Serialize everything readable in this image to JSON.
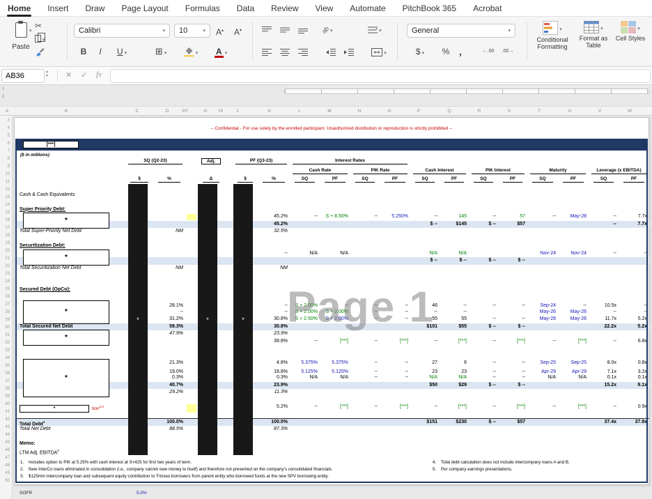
{
  "icons": {
    "chevron": "▾",
    "scissors": "✂",
    "up": "▴"
  },
  "ribbon": {
    "tabs": [
      {
        "label": "Home",
        "active": true
      },
      {
        "label": "Insert"
      },
      {
        "label": "Draw"
      },
      {
        "label": "Page Layout"
      },
      {
        "label": "Formulas"
      },
      {
        "label": "Data"
      },
      {
        "label": "Review"
      },
      {
        "label": "View"
      },
      {
        "label": "Automate"
      },
      {
        "label": "PitchBook 365"
      },
      {
        "label": "Acrobat"
      }
    ],
    "paste_label": "Paste",
    "font_name": "Calibri",
    "font_size": "10",
    "increase_font_label": "A",
    "decrease_font_label": "A",
    "bold_label": "B",
    "italic_label": "I",
    "underline_label": "U",
    "font_color_label": "A",
    "number_format": "General",
    "currency_label": "$",
    "percent_label": "%",
    "comma_label": ",",
    "increase_decimal": "←.00",
    "decrease_decimal": ".00→",
    "conditional_formatting_label": "Conditional Formatting",
    "format_as_table_label": "Format as Table",
    "cell_styles_label": "Cell Styles"
  },
  "formula_bar": {
    "name_box": "AB36",
    "cancel": "✕",
    "enter": "✓",
    "fx": "fx"
  },
  "sheet_chrome": {
    "column_letters": [
      "A",
      "B",
      "C",
      "D",
      "EF",
      "G",
      "HI",
      "J",
      "K",
      "L",
      "M",
      "N",
      "O",
      "P",
      "Q",
      "R",
      "S",
      "T",
      "U",
      "V",
      "W"
    ],
    "row_numbers": [
      "1",
      "2",
      "3",
      "4",
      "5",
      "6",
      "7",
      "8",
      "9",
      "10",
      "11",
      "12",
      "13",
      "14",
      "15",
      "16",
      "17",
      "18",
      "19",
      "20",
      "21",
      "22",
      "23",
      "24",
      "25",
      "26",
      "27",
      "28",
      "29",
      "30",
      "31",
      "32",
      "33",
      "34",
      "35",
      "36",
      "37",
      "38",
      "39",
      "40",
      "41",
      "42",
      "43",
      "44",
      "45",
      "46",
      "47",
      "48",
      "49",
      "50"
    ]
  },
  "sheet": {
    "confidential": "-- Confidential - For use solely by the enrolled participant. Unauthorized distribution or reproduction is strictly prohibited --",
    "title_box": "[***]",
    "units": "($ in millions)",
    "watermark": "Page 1",
    "redaction_mark": "*",
    "headers": {
      "h1": [
        {
          "t": "SQ (Q2-23)",
          "s": "cd"
        },
        {
          "t": "Adj.",
          "s": "g",
          "box": true
        },
        {
          "t": "PF (Q3-23)",
          "s": "jk"
        },
        {
          "t": "Interest Rates",
          "s": "lo"
        }
      ],
      "h2": [
        {
          "t": "Cash Rate",
          "s": "lm"
        },
        {
          "t": "PIK Rate",
          "s": "no"
        },
        {
          "t": "Cash Interest",
          "s": "pq"
        },
        {
          "t": "PIK Interest",
          "s": "rs"
        },
        {
          "t": "Maturity",
          "s": "tu"
        },
        {
          "t": "Leverage (x EBITDA)",
          "s": "vw"
        }
      ],
      "h3": [
        {
          "t": "$",
          "col": "c"
        },
        {
          "t": "%",
          "col": "d"
        },
        {
          "t": "Δ",
          "col": "g"
        },
        {
          "t": "$",
          "col": "j"
        },
        {
          "t": "%",
          "col": "k"
        },
        {
          "t": "SQ",
          "col": "l"
        },
        {
          "t": "PF",
          "col": "m"
        },
        {
          "t": "SQ",
          "col": "n"
        },
        {
          "t": "PF",
          "col": "o"
        },
        {
          "t": "SQ",
          "col": "p"
        },
        {
          "t": "PF",
          "col": "q"
        },
        {
          "t": "SQ",
          "col": "r"
        },
        {
          "t": "PF",
          "col": "s"
        },
        {
          "t": "SQ",
          "col": "t"
        },
        {
          "t": "PF",
          "col": "u"
        },
        {
          "t": "SQ",
          "col": "v"
        },
        {
          "t": "PF",
          "col": "w"
        }
      ]
    },
    "rows": [
      {},
      {
        "n": "Cash & Cash Equivalents"
      },
      {},
      {
        "n": "Super Priority Debt:",
        "s": "sec"
      },
      {
        "y": true,
        "c": [
          "",
          "45.2%",
          "--",
          [
            "S + 8.50%",
            "g"
          ],
          "--",
          [
            "5.250%",
            "bl"
          ],
          "--",
          [
            "145",
            "g"
          ],
          "--",
          [
            "57",
            "g"
          ],
          "--",
          [
            "May-28",
            "bl"
          ],
          "--",
          "7.7x"
        ]
      },
      {
        "s": "tot",
        "c": [
          "",
          "45.2%",
          "",
          "",
          "",
          "",
          "$ --",
          "$145",
          "$ --",
          "$57",
          "",
          "",
          "--",
          "7.7x"
        ]
      },
      {
        "n": "Total Super-Priority Net Debt",
        "s": "it",
        "c": [
          "NM",
          "32.5%",
          "",
          "",
          "",
          "",
          "",
          "",
          "",
          "",
          "",
          "",
          "",
          ""
        ]
      },
      {},
      {
        "n": "Securitization Debt:",
        "s": "sec"
      },
      {
        "c": [
          "",
          "--",
          "N/A",
          "N/A",
          "",
          "",
          [
            "N/A",
            "g"
          ],
          [
            "N/A",
            "g"
          ],
          "",
          "",
          [
            "Nov-24",
            "bl"
          ],
          [
            "Nov-24",
            "bl"
          ],
          "--",
          "--"
        ]
      },
      {
        "s": "tot",
        "c": [
          "",
          "",
          "",
          "",
          "",
          "",
          "$ --",
          "$ --",
          "$ --",
          "$ --",
          "",
          "",
          "",
          ""
        ]
      },
      {
        "n": "Total Securitization Net Debt",
        "s": "it",
        "c": [
          "NM",
          "NM",
          "",
          "",
          "",
          "",
          "",
          "",
          "",
          "",
          "",
          "",
          "",
          ""
        ]
      },
      {},
      {},
      {
        "n": "Secured Debt (OpCo):",
        "s": "sec"
      },
      {},
      {
        "y": true,
        "c": [
          "28.1%",
          "--",
          [
            "S + 2.00%",
            "g"
          ],
          "--",
          "--",
          "--",
          "46",
          "--",
          "--",
          "--",
          [
            "Sep-24",
            "bl"
          ],
          "--",
          "10.5x",
          "--"
        ]
      },
      {
        "c": [
          "--",
          "--",
          [
            "S + 2.00%",
            "g"
          ],
          [
            "S + 2.00%",
            "g"
          ],
          "--",
          "--",
          "--",
          "--",
          "",
          "",
          [
            "May-26",
            "bl"
          ],
          [
            "May-26",
            "bl"
          ],
          "--",
          "--"
        ]
      },
      {
        "c": [
          "31.2%",
          "30.8%",
          [
            "S + 2.50%",
            "g"
          ],
          [
            "S + 2.50%",
            "bl"
          ],
          "--",
          "--",
          "55",
          "55",
          "--",
          "--",
          [
            "May-28",
            "bl"
          ],
          [
            "May-26",
            "bl"
          ],
          "11.7x",
          "5.2x"
        ]
      },
      {
        "n": "Total Secured Net Debt",
        "s": "tot",
        "c": [
          "59.3%",
          "30.8%",
          "",
          "",
          "",
          "",
          "$101",
          "$55",
          "$ --",
          "$ --",
          "",
          "",
          "22.2x",
          "5.2x"
        ]
      },
      {
        "s": "it",
        "c": [
          "47.9%",
          "23.9%",
          "",
          "",
          "",
          "",
          "",
          "",
          "",
          "",
          "",
          "",
          "",
          ""
        ]
      },
      {
        "c": [
          "",
          "39.8%",
          "--",
          [
            "[***]",
            "g"
          ],
          "--",
          [
            "[***]",
            "g"
          ],
          "--",
          [
            "[***]",
            "g"
          ],
          "--",
          [
            "[***]",
            "g"
          ],
          "--",
          [
            "[***]",
            "g"
          ],
          "--",
          "6.8x"
        ]
      },
      {},
      {},
      {
        "c": [
          "21.3%",
          "4.8%",
          [
            "5.375%",
            "bl"
          ],
          [
            "5.375%",
            "bl"
          ],
          "--",
          "--",
          "27",
          "6",
          "--",
          "--",
          [
            "Sep-25",
            "bl"
          ],
          [
            "Sep-25",
            "bl"
          ],
          "8.0x",
          "0.8x"
        ]
      },
      {
        "y": true,
        "c": [
          "19.0%",
          "18.8%",
          [
            "5.125%",
            "bl"
          ],
          [
            "5.125%",
            "bl"
          ],
          "--",
          "--",
          "23",
          "23",
          "--",
          "--",
          [
            "Apr-29",
            "bl"
          ],
          [
            "Apr-29",
            "bl"
          ],
          "7.1x",
          "3.2x"
        ]
      },
      {
        "c": [
          "0.3%",
          "0.3%",
          "N/A",
          "N/A",
          "--",
          "--",
          [
            "N/A",
            "g"
          ],
          [
            "N/A",
            "g"
          ],
          "--",
          "--",
          "N/A",
          "N/A",
          "0.1x",
          "0.1x"
        ]
      },
      {
        "s": "tot",
        "c": [
          "40.7%",
          "23.9%",
          "",
          "",
          "",
          "",
          "$50",
          "$29",
          "$ --",
          "$ --",
          "",
          "",
          "15.2x",
          "9.1x"
        ]
      },
      {
        "s": "it",
        "c": [
          "29.2%",
          "11.3%",
          "",
          "",
          "",
          "",
          "",
          "",
          "",
          "",
          "",
          "",
          "",
          ""
        ]
      },
      {},
      {
        "n": "tion",
        "sup": "2,3",
        "s": "redlbl",
        "y": true,
        "c": [
          "",
          "5.2%",
          "--",
          [
            "[***]",
            "g"
          ],
          "--",
          [
            "[***]",
            "g"
          ],
          "--",
          [
            "[***]",
            "g"
          ],
          "--",
          [
            "[***]",
            "g"
          ],
          "--",
          [
            "[***]",
            "g"
          ],
          "--",
          "0.9x"
        ]
      },
      {},
      {
        "n": "Total Debt",
        "sup": "4",
        "s": "tot2",
        "c": [
          "100.0%",
          "100.0%",
          "",
          "",
          "",
          "",
          "$151",
          "$230",
          "$ --",
          "$57",
          "",
          "",
          "37.4x",
          "37.9x"
        ]
      },
      {
        "n": "Total Net Debt",
        "s": "it",
        "c": [
          "88.5%",
          "87.3%",
          "",
          "",
          "",
          "",
          "",
          "",
          "",
          "",
          "",
          "",
          "",
          ""
        ]
      },
      {},
      {
        "n": "Memo:",
        "s": "b"
      },
      {
        "n": "LTM Adj. EBITDA",
        "sup": "5"
      }
    ],
    "redaction_boxes": [
      {
        "rows": [
          4,
          5
        ]
      },
      {
        "rows": [
          9,
          10
        ]
      },
      {
        "rows": [
          16,
          18
        ]
      },
      {
        "rows": [
          20,
          21
        ]
      },
      {
        "rows": [
          24,
          28
        ]
      }
    ],
    "redaction_bars": [
      {
        "col": "c"
      },
      {
        "col": "g"
      },
      {
        "col": "j"
      }
    ],
    "footnotes_left": [
      {
        "n": "1.",
        "t": "Includes option to PIK at 5.25% with cash interest at S+425 for first two years of term."
      },
      {
        "n": "2.",
        "t": "New InterCo loans eliminated in consolidation (i.e., company cannot owe money to itself) and therefore not presented on the company's consolidated financials."
      },
      {
        "n": "3.",
        "t": "$125mm Intercompany loan and subsequent equity contribution to Trinseo borrowers from parent entity who borrowed funds at the new SPV borrowing entity."
      }
    ],
    "footnotes_right": [
      {
        "n": "4.",
        "t": "Total debt calculation does not include intercompany loans A and B."
      },
      {
        "n": "5.",
        "t": "Per company earnings presentations."
      }
    ],
    "bottom": {
      "label": "SOFR",
      "value": "5.0%"
    }
  }
}
